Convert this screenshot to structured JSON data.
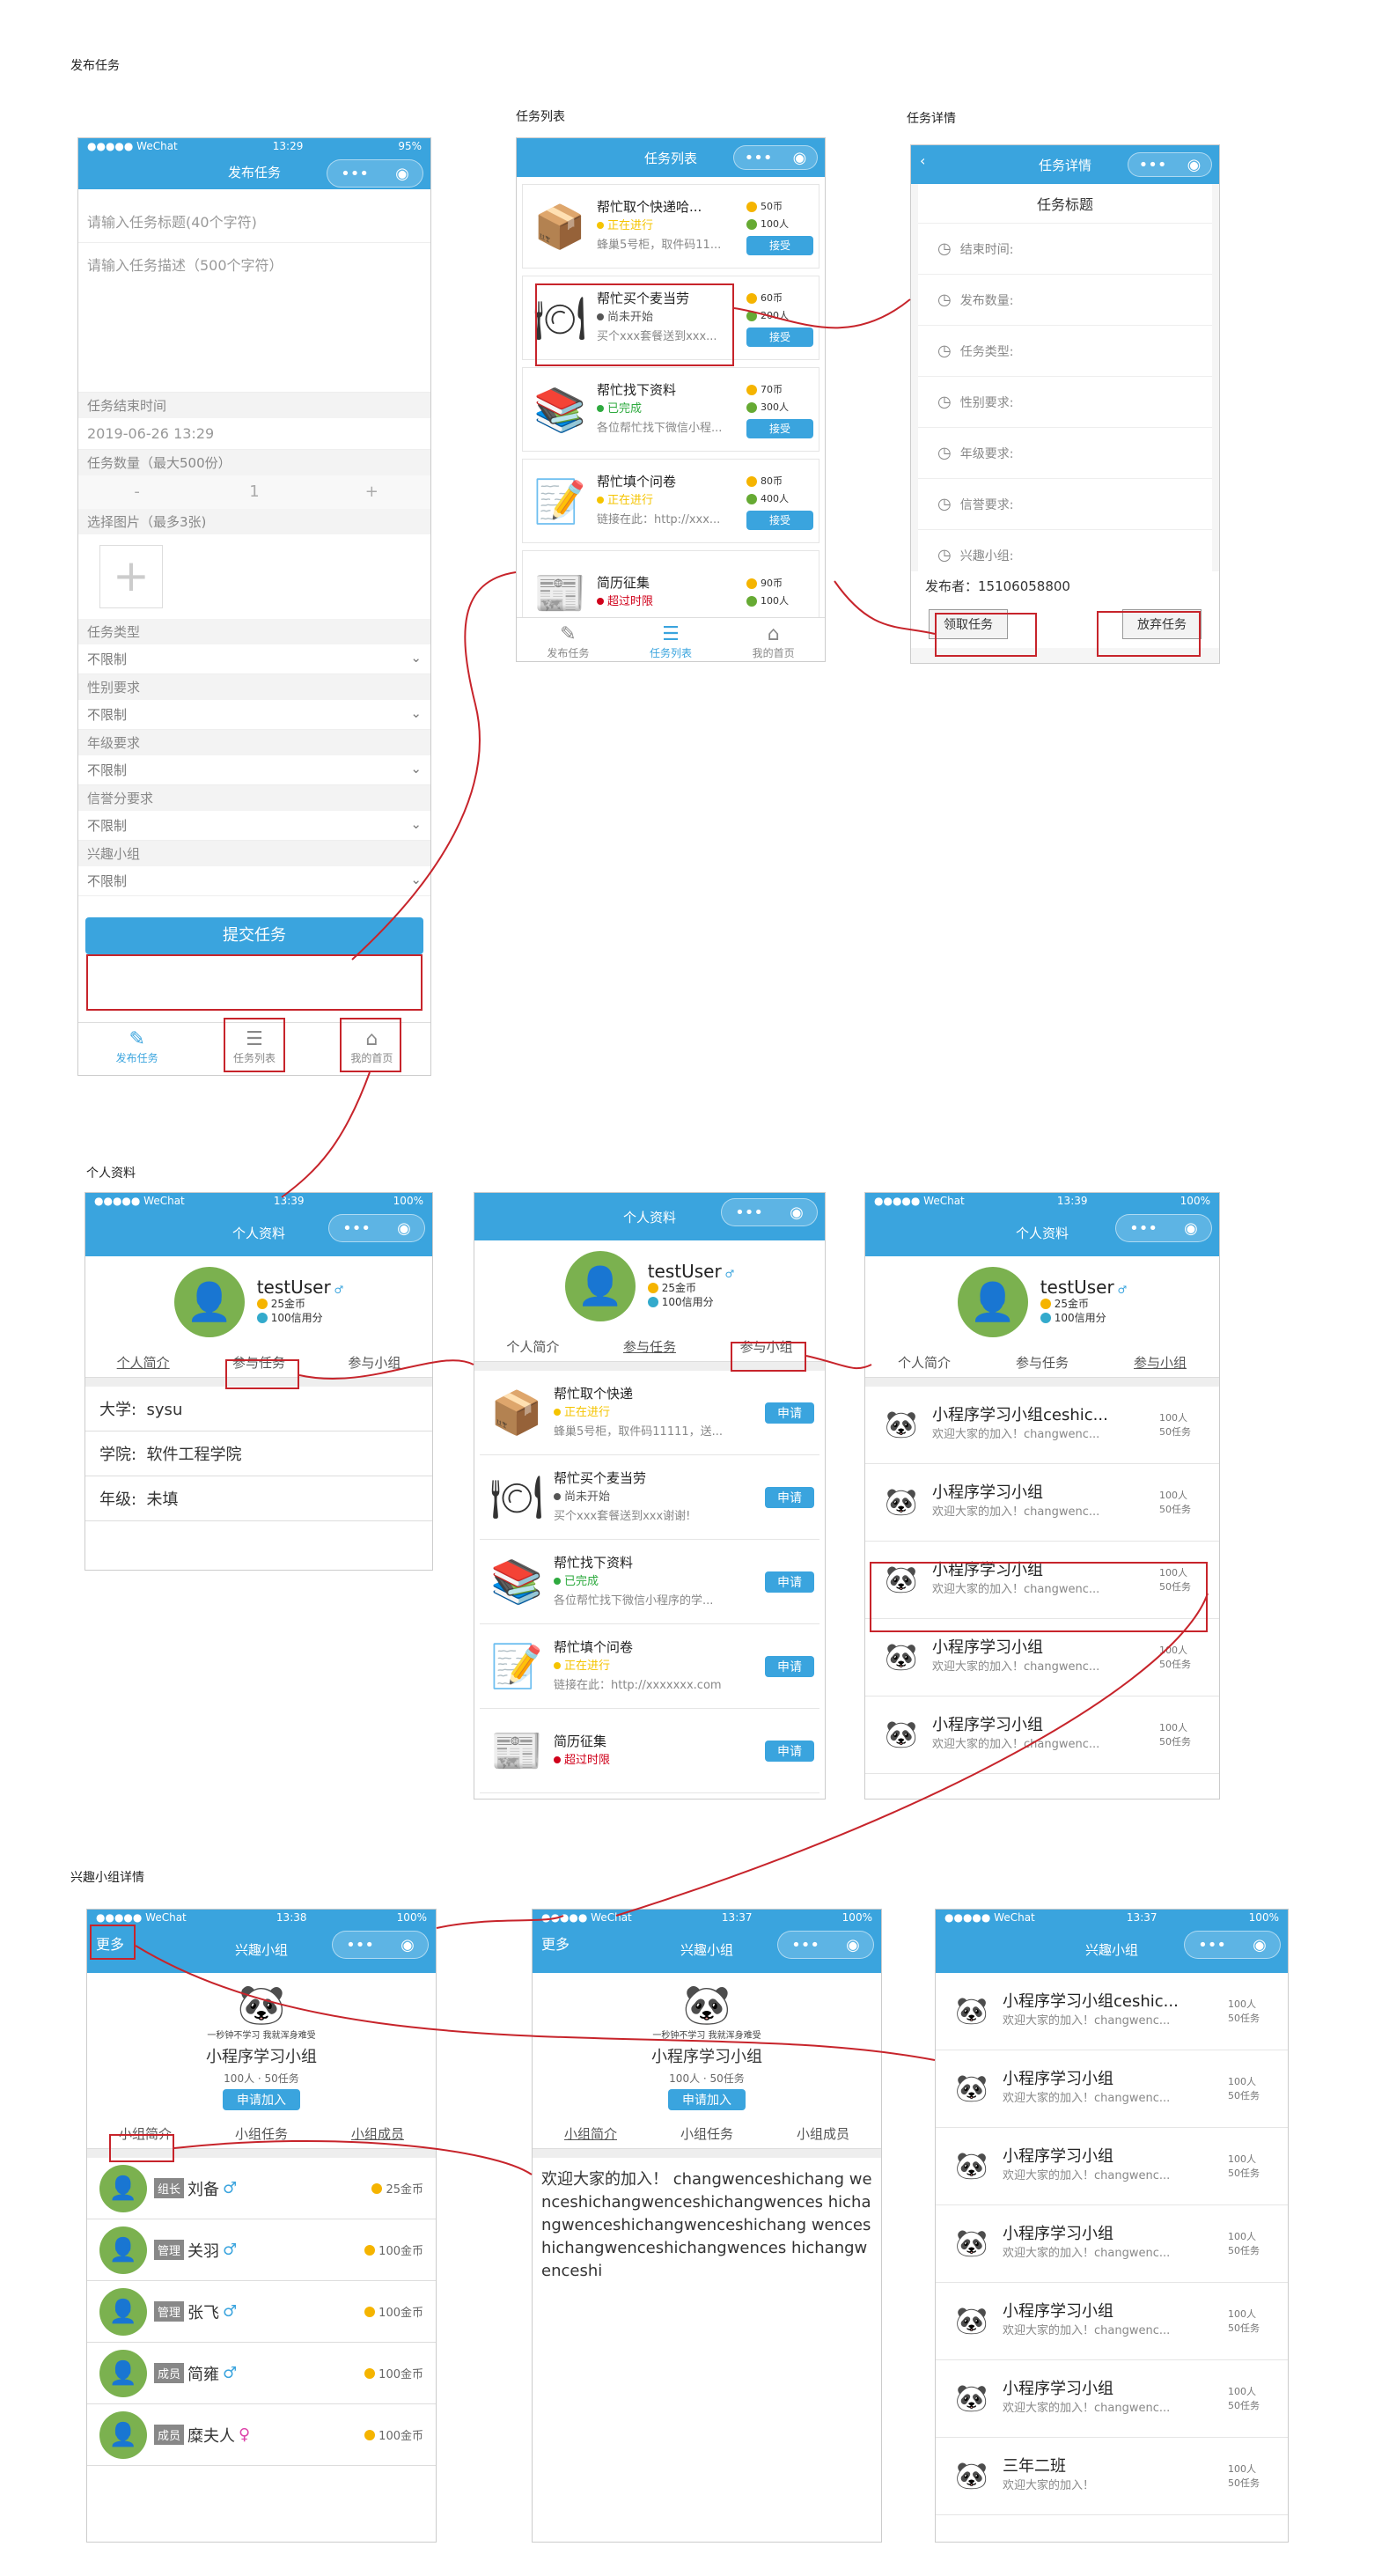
{
  "labels": {
    "publish": "发布任务",
    "list": "任务列表",
    "detail": "任务详情",
    "profile": "个人资料",
    "group": "兴趣小组详情"
  },
  "status": {
    "carrier": "●●●●● WeChat",
    "t1329": "13:29",
    "t1339": "13:39",
    "t1338": "13:38",
    "t1337": "13:37",
    "b95": "95%",
    "b100": "100%"
  },
  "publish": {
    "title": "发布任务",
    "ph_title": "请输入任务标题(40个字符)",
    "ph_desc": "请输入任务描述（500个字符）",
    "end_label": "任务结束时间",
    "end_value": "2019-06-26 13:29",
    "count_label": "任务数量（最大500份）",
    "minus": "-",
    "count_value": "1",
    "plus": "+",
    "img_label": "选择图片（最多3张)",
    "add": "+",
    "f1": "任务类型",
    "f2": "性别要求",
    "f3": "年级要求",
    "f4": "信誉分要求",
    "f5": "兴趣小组",
    "unlimited": "不限制",
    "submit": "提交任务"
  },
  "nav": {
    "n1": "发布任务",
    "n2": "任务列表",
    "n3": "我的首页"
  },
  "list": {
    "title": "任务列表",
    "tasks": [
      {
        "title": "帮忙取个快递哈...",
        "status": "正在进行",
        "desc": "蜂巢5号柜，取件码11...",
        "reward": "50币",
        "people": "100人",
        "btn": "接受",
        "icon": "📦",
        "color": "#f5c400"
      },
      {
        "title": "帮忙买个麦当劳",
        "status": "尚未开始",
        "desc": "买个xxx套餐送到xxx...",
        "reward": "60币",
        "people": "200人",
        "btn": "接受",
        "icon": "🍽",
        "color": "#555"
      },
      {
        "title": "帮忙找下资料",
        "status": "已完成",
        "desc": "各位帮忙找下微信小程...",
        "reward": "70币",
        "people": "300人",
        "btn": "接受",
        "icon": "📚",
        "color": "#2eaa3f"
      },
      {
        "title": "帮忙填个问卷",
        "status": "正在进行",
        "desc": "链接在此：http://xxx...",
        "reward": "80币",
        "people": "400人",
        "btn": "接受",
        "icon": "📝",
        "color": "#f5c400"
      },
      {
        "title": "简历征集",
        "status": "超过时限",
        "desc": "",
        "reward": "90币",
        "people": "100人",
        "btn": "",
        "icon": "📰",
        "color": "#d0021b"
      }
    ]
  },
  "detail": {
    "title": "任务详情",
    "heading": "任务标题",
    "rows": [
      "结束时间:",
      "发布数量:",
      "任务类型:",
      "性别要求:",
      "年级要求:",
      "信誉要求:",
      "兴趣小组:"
    ],
    "publisher": "发布者：15106058800",
    "take": "领取任务",
    "give": "放弃任务"
  },
  "profile": {
    "title": "个人资料",
    "name": "testUser",
    "gender": "♂",
    "coins": "25金币",
    "credit": "100信用分",
    "tab1": "个人简介",
    "tab2": "参与任务",
    "tab3": "参与小组",
    "univ_k": "大学:",
    "univ_v": "sysu",
    "school_k": "学院:",
    "school_v": "软件工程学院",
    "grade_k": "年级:",
    "grade_v": "未填"
  },
  "ptasks": [
    {
      "title": "帮忙取个快递",
      "status": "正在进行",
      "desc": "蜂巢5号柜，取件码11111，送...",
      "btn": "申请",
      "icon": "📦",
      "color": "#f5c400"
    },
    {
      "title": "帮忙买个麦当劳",
      "status": "尚未开始",
      "desc": "买个xxx套餐送到xxx谢谢!",
      "btn": "申请",
      "icon": "🍽",
      "color": "#555"
    },
    {
      "title": "帮忙找下资料",
      "status": "已完成",
      "desc": "各位帮忙找下微信小程序的学...",
      "btn": "申请",
      "icon": "📚",
      "color": "#2eaa3f"
    },
    {
      "title": "帮忙填个问卷",
      "status": "正在进行",
      "desc": "链接在此：http://xxxxxxx.com",
      "btn": "申请",
      "icon": "📝",
      "color": "#f5c400"
    },
    {
      "title": "简历征集",
      "status": "超过时限",
      "desc": "",
      "btn": "申请",
      "icon": "📰",
      "color": "#d0021b"
    }
  ],
  "groups": [
    {
      "name": "小程序学习小组ceshic...",
      "desc": "欢迎大家的加入！changwenc...",
      "people": "100人",
      "tasks": "50任务"
    },
    {
      "name": "小程序学习小组",
      "desc": "欢迎大家的加入！changwenc...",
      "people": "100人",
      "tasks": "50任务"
    },
    {
      "name": "小程序学习小组",
      "desc": "欢迎大家的加入！changwenc...",
      "people": "100人",
      "tasks": "50任务"
    },
    {
      "name": "小程序学习小组",
      "desc": "欢迎大家的加入！changwenc...",
      "people": "100人",
      "tasks": "50任务"
    },
    {
      "name": "小程序学习小组",
      "desc": "欢迎大家的加入！changwenc...",
      "people": "100人",
      "tasks": "50任务"
    },
    {
      "name": "小程序学习小组",
      "desc": "欢迎大家的加入！changwenc...",
      "people": "100人",
      "tasks": "50任务"
    },
    {
      "name": "三年二班",
      "desc": "欢迎大家的加入！",
      "people": "100人",
      "tasks": "50任务"
    }
  ],
  "group": {
    "title": "兴趣小组",
    "more": "更多",
    "name": "小程序学习小组",
    "people": "100人",
    "tasks": "50任务",
    "join": "申请加入",
    "tab1": "小组简介",
    "tab2": "小组任务",
    "tab3": "小组成员",
    "intro": "欢迎大家的加入！ changwenceshichang wenceshichangwenceshichangwences hichangwenceshichangwenceshichang wenceshichangwenceshichangwences hichangwenceshi",
    "meme": "一秒钟不学习 我就浑身难受"
  },
  "members": [
    {
      "role": "组长",
      "name": "刘备",
      "gender": "♂",
      "coins": "25金币"
    },
    {
      "role": "管理",
      "name": "关羽",
      "gender": "♂",
      "coins": "100金币"
    },
    {
      "role": "管理",
      "name": "张飞",
      "gender": "♂",
      "coins": "100金币"
    },
    {
      "role": "成员",
      "name": "简雍",
      "gender": "♂",
      "coins": "100金币"
    },
    {
      "role": "成员",
      "name": "糜夫人",
      "gender": "♀",
      "coins": "100金币"
    }
  ],
  "colors": {
    "primary": "#3aa4de",
    "annotation": "#c7242b"
  }
}
